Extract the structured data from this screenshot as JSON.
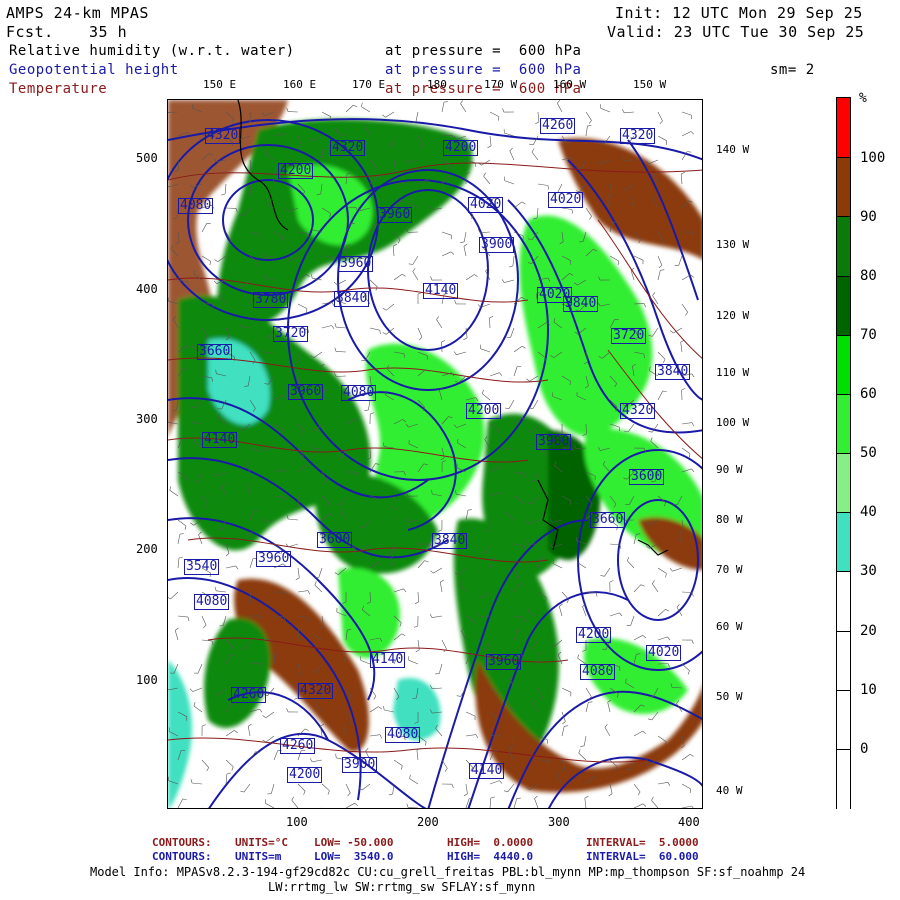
{
  "header": {
    "model": "AMPS 24-km MPAS",
    "fcst_label": "Fcst.",
    "fcst_value": "35 h",
    "init": "Init: 12 UTC Mon 29 Sep 25",
    "valid": "Valid: 23 UTC Tue 30 Sep 25"
  },
  "fields": [
    {
      "name": "Relative humidity (w.r.t. water)",
      "level": "at pressure =  600 hPa",
      "color": "#000000"
    },
    {
      "name": "Geopotential height",
      "level": "at pressure =  600 hPa",
      "color": "#1a1aa8"
    },
    {
      "name": "Temperature",
      "level": "at pressure =  600 hPa",
      "color": "#8b1a1a"
    }
  ],
  "smoothing": "sm= 2",
  "top_longitudes": [
    "150 E",
    "160 E",
    "170 E",
    "180",
    "170 W",
    "160 W",
    "150 W"
  ],
  "right_longitudes": [
    "140 W",
    "130 W",
    "120 W",
    "110 W",
    "100 W",
    "90 W",
    "80 W",
    "70 W",
    "60 W",
    "50 W",
    "40 W"
  ],
  "x_ticks": [
    "100",
    "200",
    "300",
    "400"
  ],
  "y_ticks": [
    "500",
    "400",
    "300",
    "200",
    "100"
  ],
  "colorbar": {
    "unit": "%",
    "labels": [
      "100",
      "90",
      "80",
      "70",
      "60",
      "50",
      "40",
      "30",
      "20",
      "10",
      "0"
    ],
    "colors": [
      "#ff0000",
      "#8b3a0a",
      "#0a7a0a",
      "#006400",
      "#00e000",
      "#33ee33",
      "#88ee88",
      "#40e0c0",
      "#ffffff",
      "#ffffff",
      "#ffffff",
      "#ffffff"
    ]
  },
  "height_labels": [
    "4320",
    "4320",
    "4200",
    "4260",
    "4320",
    "4200",
    "4080",
    "3960",
    "4020",
    "4020",
    "3900",
    "3960",
    "4140",
    "4020",
    "3840",
    "3780",
    "3840",
    "3720",
    "3660",
    "3720",
    "3840",
    "3960",
    "4080",
    "4140",
    "4200",
    "4320",
    "3900",
    "3600",
    "3540",
    "3960",
    "3840",
    "3600",
    "3660",
    "4080",
    "4140",
    "4200",
    "3960",
    "4080",
    "4260",
    "4320",
    "4020",
    "4080",
    "4260",
    "4200",
    "3900",
    "4140"
  ],
  "footer": {
    "line1": {
      "label": "CONTOURS:",
      "units": "UNITS=°C",
      "low": "LOW= -50.000",
      "high": "HIGH=  0.0000",
      "interval": "INTERVAL=  5.0000"
    },
    "line2": {
      "label": "CONTOURS:",
      "units": "UNITS=m",
      "low": "LOW=  3540.0",
      "high": "HIGH=  4440.0",
      "interval": "INTERVAL=  60.000"
    },
    "model_info": "Model Info: MPASv8.2.3-194-gf29cd82c CU:cu_grell_freitas PBL:bl_mynn MP:mp_thompson SF:sf_noahmp 24",
    "model_info2": "LW:rrtmg_lw SW:rrtmg_sw SFLAY:sf_mynn"
  }
}
